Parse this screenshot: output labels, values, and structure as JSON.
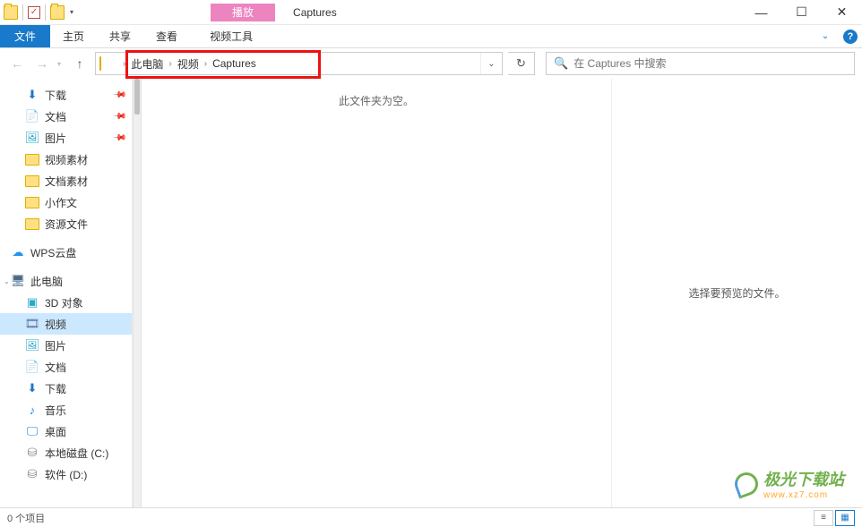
{
  "window": {
    "contextual_tab": "播放",
    "title": "Captures"
  },
  "ribbon": {
    "file": "文件",
    "tabs": [
      "主页",
      "共享",
      "查看"
    ],
    "video_tools": "视频工具"
  },
  "address": {
    "crumbs": [
      "此电脑",
      "视频",
      "Captures"
    ]
  },
  "search": {
    "placeholder": "在 Captures 中搜索"
  },
  "sidebar": {
    "quick": [
      {
        "label": "下载",
        "icon": "download",
        "pinned": true
      },
      {
        "label": "文档",
        "icon": "document",
        "pinned": true
      },
      {
        "label": "图片",
        "icon": "picture",
        "pinned": true
      },
      {
        "label": "视频素材",
        "icon": "folder"
      },
      {
        "label": "文档素材",
        "icon": "folder"
      },
      {
        "label": "小作文",
        "icon": "folder"
      },
      {
        "label": "资源文件",
        "icon": "folder"
      }
    ],
    "wps": "WPS云盘",
    "pc": "此电脑",
    "pc_children": [
      {
        "label": "3D 对象",
        "icon": "3d"
      },
      {
        "label": "视频",
        "icon": "video",
        "selected": true
      },
      {
        "label": "图片",
        "icon": "picture"
      },
      {
        "label": "文档",
        "icon": "document"
      },
      {
        "label": "下载",
        "icon": "download"
      },
      {
        "label": "音乐",
        "icon": "music"
      },
      {
        "label": "桌面",
        "icon": "desktop"
      },
      {
        "label": "本地磁盘 (C:)",
        "icon": "disk"
      },
      {
        "label": "软件 (D:)",
        "icon": "disk"
      }
    ]
  },
  "content": {
    "empty_text": "此文件夹为空。"
  },
  "preview": {
    "placeholder": "选择要预览的文件。"
  },
  "status": {
    "item_count": "0 个项目"
  },
  "watermark": {
    "text": "极光下载站",
    "sub": "www.xz7.com"
  }
}
